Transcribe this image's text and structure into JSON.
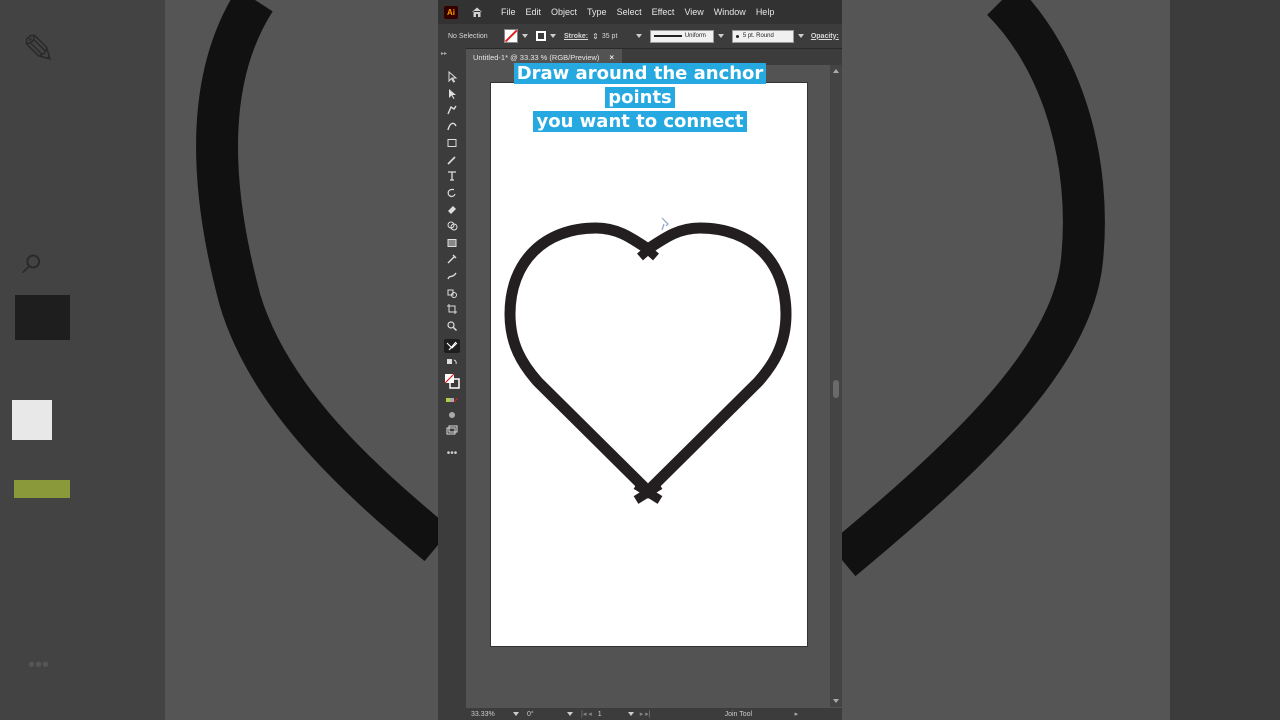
{
  "menubar": {
    "app_icon": "Ai",
    "items": [
      "File",
      "Edit",
      "Object",
      "Type",
      "Select",
      "Effect",
      "View",
      "Window",
      "Help"
    ]
  },
  "controlbar": {
    "selection": "No Selection",
    "stroke_label": "Stroke:",
    "stroke_weight": "35 pt",
    "profile": "Uniform",
    "brush": "5 pt. Round",
    "opacity_label": "Opacity:"
  },
  "document": {
    "tab_title": "Untitled-1* @ 33.33 % (RGB/Preview)",
    "close_glyph": "×"
  },
  "caption": {
    "line1": "Draw around the anchor points",
    "line2": "you want to connect"
  },
  "statusbar": {
    "zoom": "33.33%",
    "rotation": "0°",
    "artboard": "1",
    "tool": "Join Tool"
  },
  "colors": {
    "caption_bg": "#25a9e0",
    "stroke": "#231f20",
    "ui_dark": "#323232",
    "ui_panel": "#3c3c3c",
    "canvas": "#535353"
  },
  "icons": [
    "home-icon",
    "selection-tool-icon",
    "direct-selection-tool-icon",
    "pen-tool-icon",
    "curvature-tool-icon",
    "rectangle-tool-icon",
    "paintbrush-tool-icon",
    "type-tool-icon",
    "rotate-tool-icon",
    "eraser-tool-icon",
    "shape-builder-tool-icon",
    "gradient-tool-icon",
    "eyedropper-tool-icon",
    "puppet-warp-tool-icon",
    "symbol-sprayer-icon",
    "artboard-tool-icon",
    "zoom-tool-icon",
    "join-tool-icon",
    "fill-stroke-icon",
    "more-tools-icon"
  ]
}
